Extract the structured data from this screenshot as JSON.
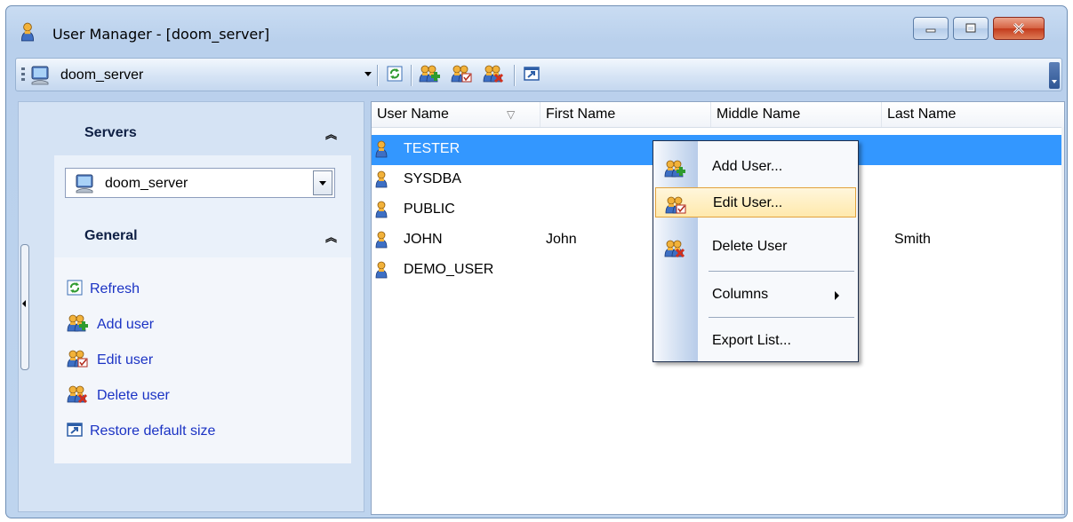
{
  "window": {
    "title": "User Manager - [doom_server]",
    "controls": [
      "minimize",
      "maximize",
      "close"
    ]
  },
  "toolbar": {
    "server_combo_value": "doom_server",
    "buttons": [
      "refresh-icon",
      "add-user-icon",
      "edit-user-icon",
      "delete-user-icon",
      "restore-size-icon"
    ]
  },
  "sidebar": {
    "servers_title": "Servers",
    "server_value": "doom_server",
    "general_title": "General",
    "items": [
      {
        "label": "Refresh",
        "icon": "refresh-icon"
      },
      {
        "label": "Add user",
        "icon": "add-user-icon"
      },
      {
        "label": "Edit user",
        "icon": "edit-user-icon"
      },
      {
        "label": "Delete user",
        "icon": "delete-user-icon"
      },
      {
        "label": "Restore default size",
        "icon": "restore-size-icon"
      }
    ]
  },
  "grid": {
    "columns": [
      "User Name",
      "First Name",
      "Middle Name",
      "Last Name"
    ],
    "sort_glyph": "▽",
    "rows": [
      {
        "user": "TESTER",
        "first": "",
        "middle": "",
        "last": "",
        "selected": true
      },
      {
        "user": "SYSDBA",
        "first": "",
        "middle": "",
        "last": ""
      },
      {
        "user": "PUBLIC",
        "first": "",
        "middle": "",
        "last": ""
      },
      {
        "user": "JOHN",
        "first": "John",
        "middle": "",
        "last": "Smith"
      },
      {
        "user": "DEMO_USER",
        "first": "",
        "middle": "",
        "last": ""
      }
    ]
  },
  "context_menu": {
    "items": [
      "Add User...",
      "Edit User...",
      "Delete User",
      "Columns",
      "Export List..."
    ],
    "highlighted": "Edit User..."
  },
  "colors": {
    "selection": "#3397ff",
    "link": "#1b33c4",
    "menu_highlight": "#ffe9ac"
  }
}
